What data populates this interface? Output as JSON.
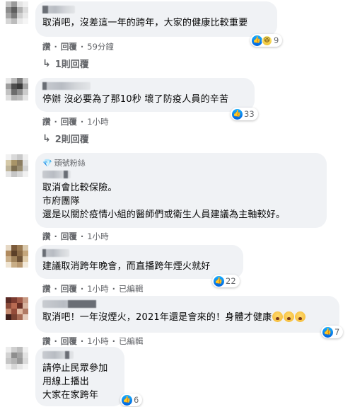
{
  "actions": {
    "like": "讚",
    "reply": "回覆",
    "edited": "已編輯"
  },
  "comments": [
    {
      "text": [
        "取消吧，沒差這一年的跨年，大家的健康比較重要"
      ],
      "time": "59分鐘",
      "reactions": {
        "count": "9",
        "icons": [
          "like-icon",
          "haha-icon"
        ]
      },
      "replies": "1則回覆"
    },
    {
      "text": [
        "停辦 沒必要為了那10秒 壞了防疫人員的辛苦"
      ],
      "time": "1小時",
      "reactions": {
        "count": "33",
        "icons": [
          "like-icon"
        ]
      },
      "replies": "2則回覆"
    },
    {
      "badge": "頭號粉絲",
      "text": [
        "取消會比較保險。",
        "市府團隊",
        "還是以關於疫情小組的醫師們或衛生人員建議為主軸較好。"
      ],
      "time": "1小時"
    },
    {
      "text": [
        "建議取消跨年晚會，而直播跨年煙火就好"
      ],
      "time": "1小時",
      "reactions": {
        "count": "22",
        "icons": [
          "like-icon"
        ]
      }
    },
    {
      "text": [
        "取消吧！一年沒煙火，2021年還是會來的！身體才健康"
      ],
      "time": "1小時",
      "reactions": {
        "count": "7",
        "icons": [
          "like-icon"
        ]
      }
    },
    {
      "text": [
        "請停止民眾參加",
        "用線上播出",
        "大家在家跨年"
      ],
      "reactions": {
        "count": "6",
        "icons": [
          "like-icon"
        ]
      }
    }
  ]
}
